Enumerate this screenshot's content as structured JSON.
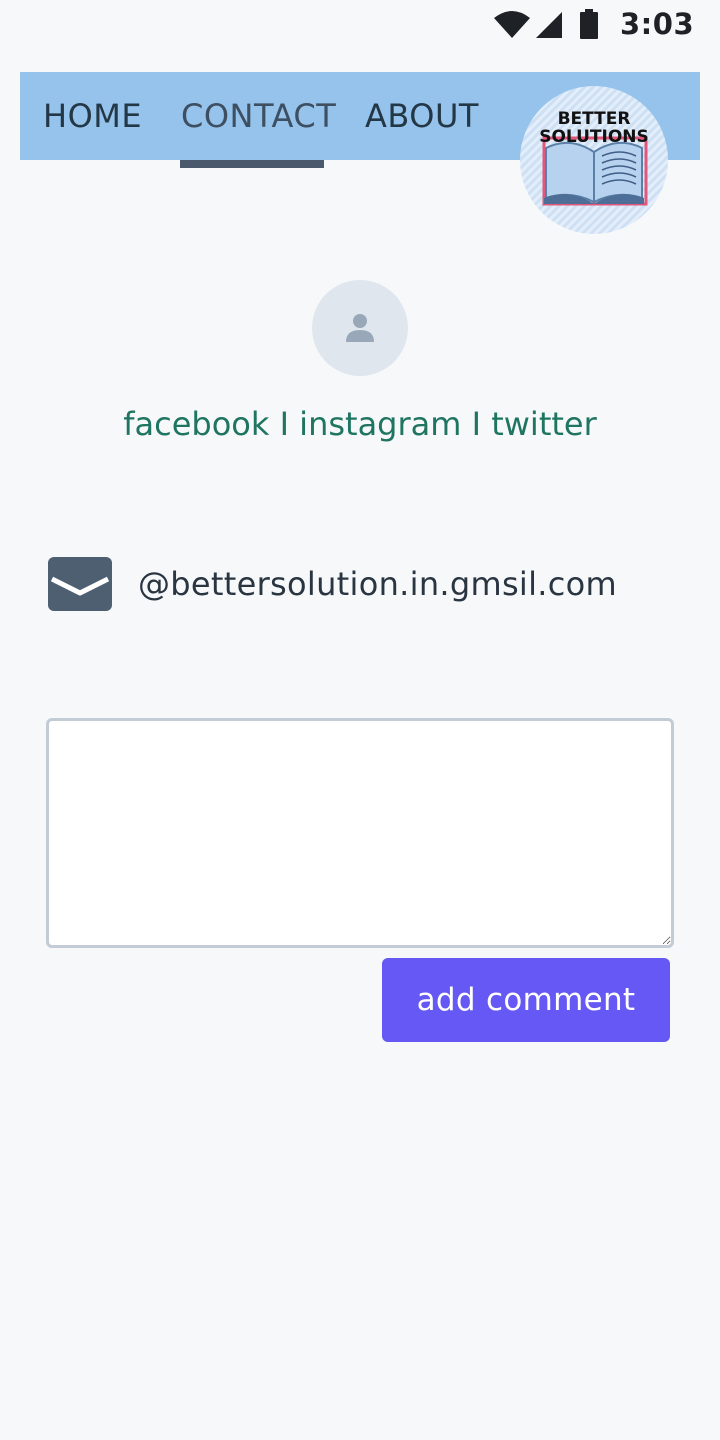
{
  "status_bar": {
    "time": "3:03",
    "icons": [
      "wifi-icon",
      "cellular-signal-icon",
      "battery-icon"
    ]
  },
  "nav": {
    "items": [
      {
        "label": "HOME",
        "active": false
      },
      {
        "label": "CONTACT",
        "active": true
      },
      {
        "label": "ABOUT",
        "active": false
      }
    ]
  },
  "logo": {
    "line1": "BETTER",
    "line2": "SOLUTIONS"
  },
  "profile": {
    "avatar_icon": "user-icon"
  },
  "social": {
    "facebook": "facebook",
    "separator": "I",
    "instagram": "instagram",
    "twitter": "twitter"
  },
  "contact": {
    "email_icon": "envelope-icon",
    "email": "@bettersolution.in.gmsil.com"
  },
  "comment": {
    "value": "",
    "button_label": "add comment"
  },
  "colors": {
    "background": "#f7f8fa",
    "nav_background": "#95c3ec",
    "nav_underline": "#4a5a6c",
    "social_link": "#1f7561",
    "button": "#6558f5",
    "button_text": "#ffffff",
    "avatar_bg": "#dfe6ee"
  }
}
